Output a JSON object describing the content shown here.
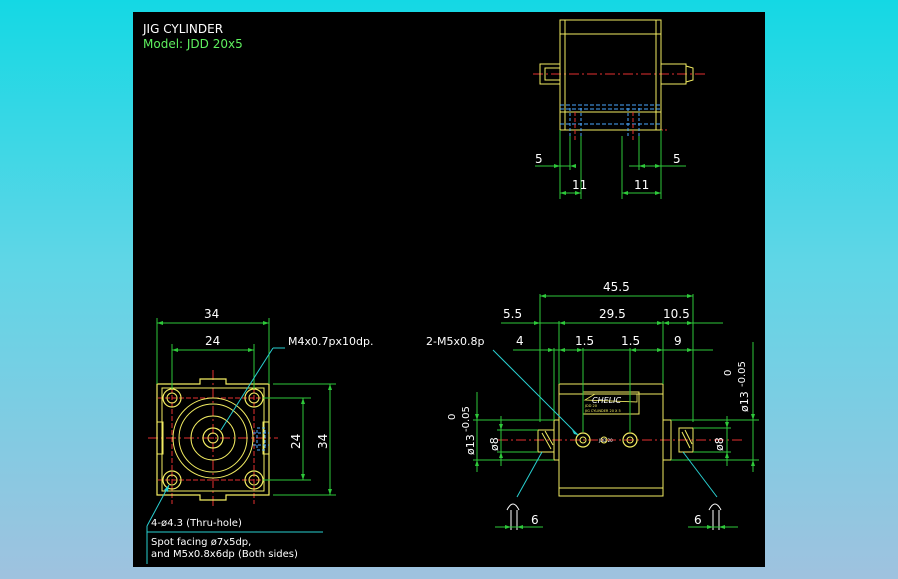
{
  "colors": {
    "background": "#000000",
    "outline": "#f2ec62",
    "dimension": "#2ec83a",
    "text_white": "#ffffff",
    "text_green": "#5ff05f",
    "centerline": "#e33030",
    "hidden": "#4aa8ff",
    "leader": "#29cfd0"
  },
  "title": {
    "line1": "JIG CYLINDER",
    "line2": "Model:  JDD 20x5"
  },
  "top_view": {
    "dims": {
      "left_small": "5",
      "right_small": "5",
      "left_width": "11",
      "right_width": "11"
    }
  },
  "front_view": {
    "dims": {
      "overall_width": "34",
      "hole_pitch": "24",
      "vertical_pitch": "24",
      "vertical_overall": "34"
    },
    "notes": {
      "tap": "M4x0.7px10dp.",
      "holes": "4-ø4.3 (Thru-hole)",
      "spot_line1": "Spot facing  ø7x5dp,",
      "spot_line2": "and M5x0.8x6dp (Both sides)"
    }
  },
  "side_view": {
    "dims": {
      "overall": "45.5",
      "left_offset": "5.5",
      "body": "29.5",
      "right_offset": "10.5",
      "port_left": "4",
      "inner_left": "1.5",
      "inner_right": "1.5",
      "port_right": "9",
      "rod_dia_left": "ø8",
      "rod_dia_right": "ø8",
      "tol_left_label": "ø13",
      "tol_left_upper": "0",
      "tol_left_lower": "-0.05",
      "tol_right_label": "ø13",
      "tol_right_upper": "0",
      "tol_right_lower": "-0.05",
      "bottom_left": "6",
      "bottom_right": "6"
    },
    "notes": {
      "port": "2-M5x0.8p",
      "brand": "CHELIC",
      "plate_line1": "JDD 20",
      "plate_line2": "JIG CYLINDER 20 X 5"
    },
    "port_label": "JDD 20"
  }
}
